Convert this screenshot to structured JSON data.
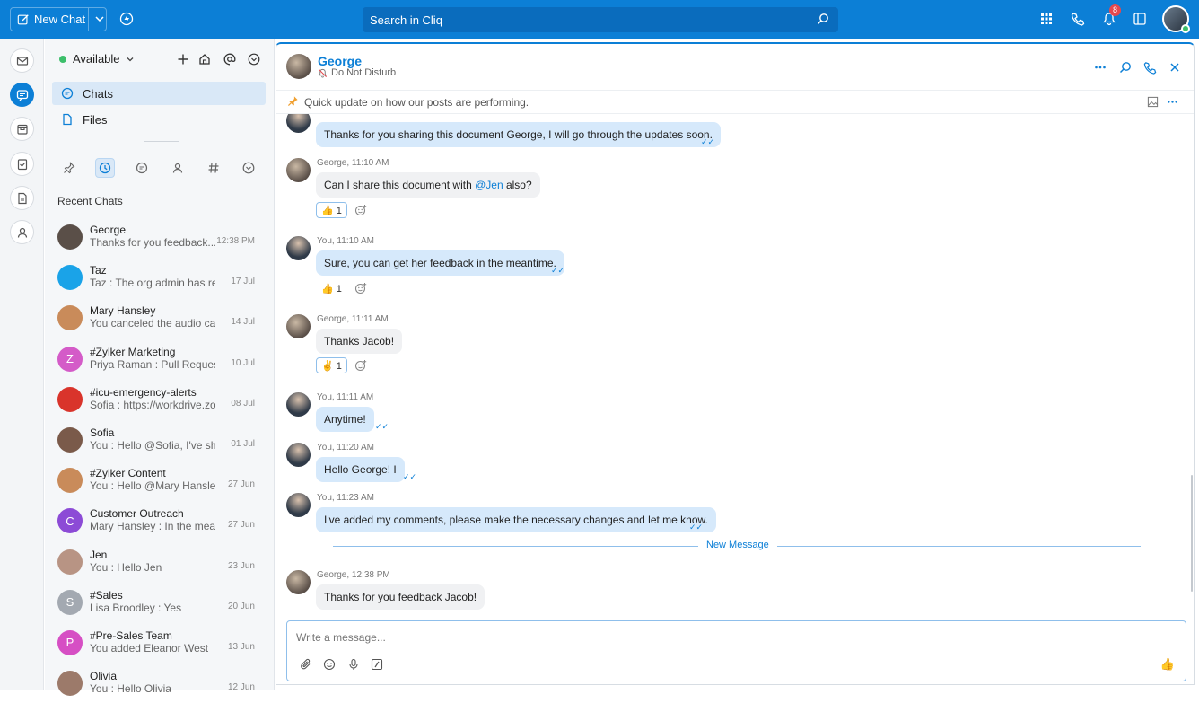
{
  "topbar": {
    "new_chat_label": "New Chat",
    "search_placeholder": "Search in Cliq",
    "notification_count": "8"
  },
  "sidebar": {
    "status": "Available",
    "nav": [
      {
        "label": "Chats"
      },
      {
        "label": "Files"
      }
    ],
    "recent_title": "Recent Chats",
    "chats": [
      {
        "name": "George",
        "preview": "Thanks for you feedback...",
        "time": "12:38 PM",
        "avatar_color": "#5a4f48",
        "initial": ""
      },
      {
        "name": "Taz",
        "preview": "Taz : The org admin has rem...",
        "time": "17 Jul",
        "avatar_color": "#1aa3e8",
        "initial": ""
      },
      {
        "name": "Mary Hansley",
        "preview": "You canceled the audio call",
        "time": "14 Jul",
        "avatar_color": "#c98b5a",
        "initial": ""
      },
      {
        "name": "#Zylker Marketing",
        "preview": "Priya Raman : Pull Request...",
        "time": "10 Jul",
        "avatar_color": "#d45bc8",
        "initial": "Z"
      },
      {
        "name": "#icu-emergency-alerts",
        "preview": "Sofia : https://workdrive.zo...",
        "time": "08 Jul",
        "avatar_color": "#d9342b",
        "initial": ""
      },
      {
        "name": "Sofia",
        "preview": "You : Hello @Sofia, I've shar...",
        "time": "01 Jul",
        "avatar_color": "#7a5a4a",
        "initial": ""
      },
      {
        "name": "#Zylker Content",
        "preview": "You : Hello @Mary Hansley...",
        "time": "27 Jun",
        "avatar_color": "#c98b5a",
        "initial": ""
      },
      {
        "name": "Customer Outreach",
        "preview": "Mary Hansley : In the mean...",
        "time": "27 Jun",
        "avatar_color": "#8c4bd6",
        "initial": "C"
      },
      {
        "name": "Jen",
        "preview": "You : Hello Jen",
        "time": "23 Jun",
        "avatar_color": "#b89484",
        "initial": ""
      },
      {
        "name": "#Sales",
        "preview": "Lisa Broodley : Yes",
        "time": "20 Jun",
        "avatar_color": "#a3a9b1",
        "initial": "S"
      },
      {
        "name": "#Pre-Sales Team",
        "preview": "You added Eleanor West",
        "time": "13 Jun",
        "avatar_color": "#d64fc4",
        "initial": "P"
      },
      {
        "name": "Olivia",
        "preview": "You : Hello Olivia",
        "time": "12 Jun",
        "avatar_color": "#9c7a6a",
        "initial": ""
      }
    ]
  },
  "chat": {
    "name": "George",
    "status": "Do Not Disturb",
    "pinned": "Quick update on how our posts are performing.",
    "new_message_label": "New Message",
    "composer_placeholder": "Write a message...",
    "messages": [
      {
        "meta": "",
        "text": "Thanks for you sharing this document George, I will go through the updates soon."
      },
      {
        "meta": "George, 11:10 AM",
        "text_pre": "Can I share this document with ",
        "mention": "@Jen",
        "text_post": " also?",
        "reaction": "👍 1"
      },
      {
        "meta": "You, 11:10 AM",
        "text": "Sure, you can get her feedback in the meantime.",
        "reaction": "👍 1"
      },
      {
        "meta": "George, 11:11 AM",
        "text": "Thanks Jacob!",
        "reaction": "✌ 1"
      },
      {
        "meta": "You, 11:11 AM",
        "text": "Anytime!"
      },
      {
        "meta": "You, 11:20 AM",
        "text": "Hello George! I"
      },
      {
        "meta": "You, 11:23 AM",
        "text": "I've added my comments, please make the necessary changes and let me know."
      },
      {
        "meta": "George, 12:38 PM",
        "text": "Thanks for you feedback Jacob!"
      }
    ]
  },
  "colors": {
    "brand": "#0c7fd6",
    "online": "#3cbf6b",
    "dnd": "#e5484d"
  }
}
